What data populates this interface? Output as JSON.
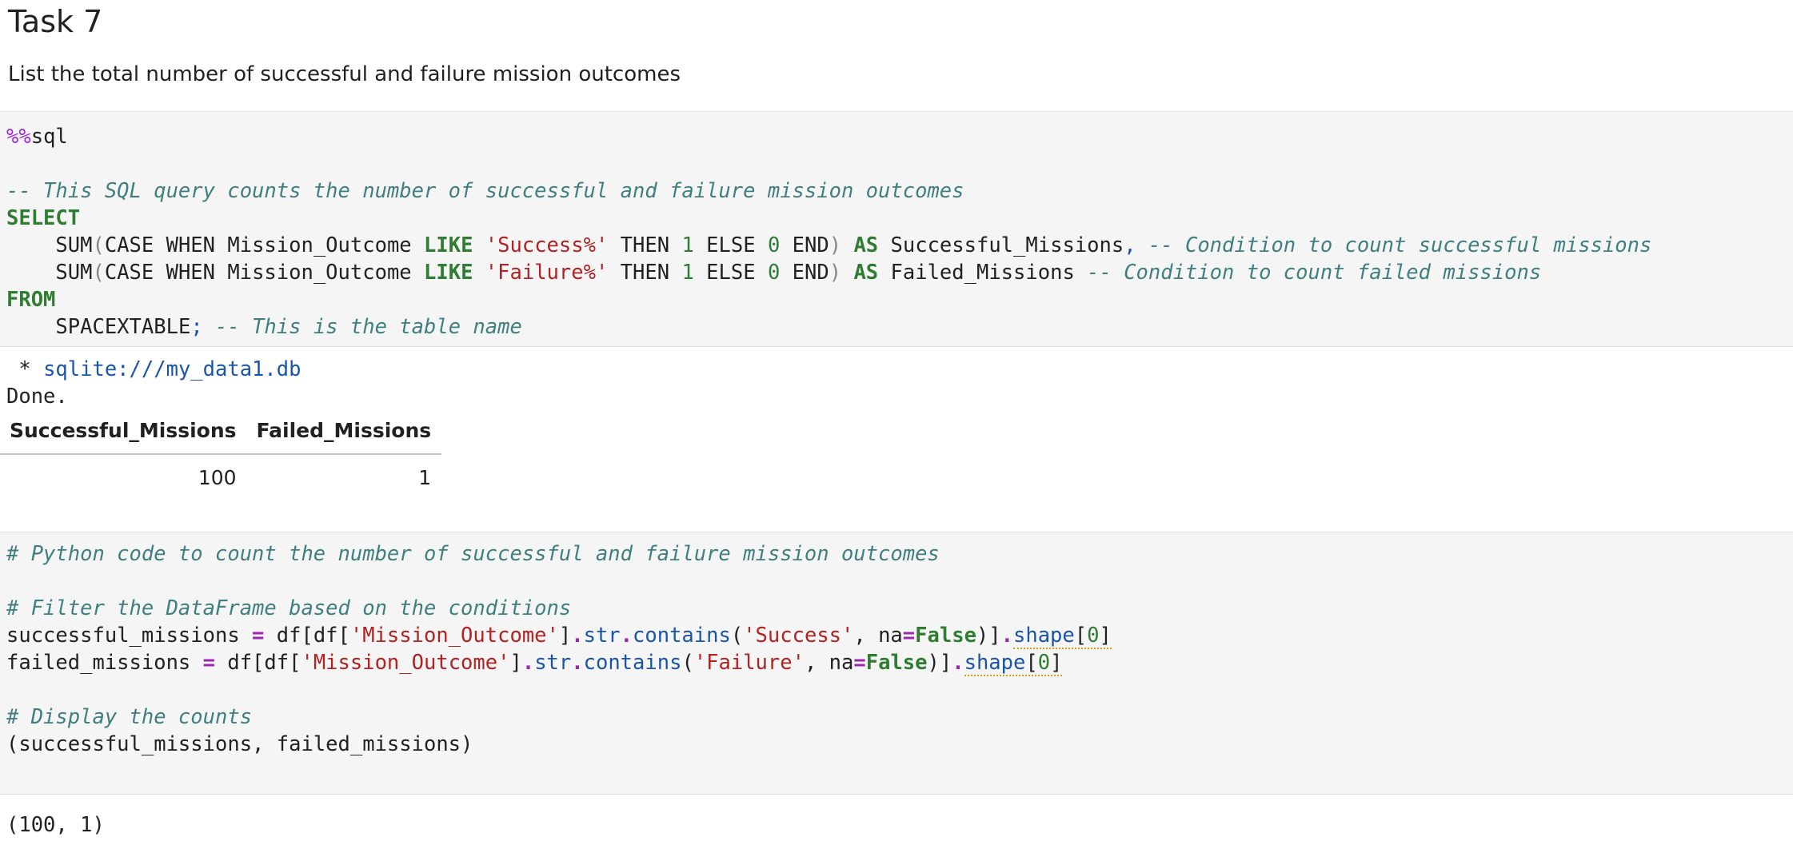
{
  "markdown": {
    "heading": "Task 7",
    "description": "List the total number of successful and failure mission outcomes"
  },
  "sql_cell": {
    "magic_prefix": "%%",
    "magic_name": "sql",
    "comment_line": "-- This SQL query counts the number of successful and failure mission outcomes",
    "kw_select": "SELECT",
    "kw_from": "FROM",
    "line1": {
      "sum": "SUM",
      "case_when": "CASE WHEN Mission_Outcome ",
      "like": "LIKE",
      "pattern": "'Success%'",
      "then": " THEN ",
      "one": "1",
      "else": " ELSE ",
      "zero": "0",
      "end": " END",
      "as": "AS",
      "alias": " Successful_Missions",
      "comma": ",",
      "comment": " -- Condition to count successful missions"
    },
    "line2": {
      "sum": "SUM",
      "case_when": "CASE WHEN Mission_Outcome ",
      "like": "LIKE",
      "pattern": "'Failure%'",
      "then": " THEN ",
      "one": "1",
      "else": " ELSE ",
      "zero": "0",
      "end": " END",
      "as": "AS",
      "alias": " Failed_Missions",
      "comment": " -- Condition to count failed missions"
    },
    "table_name": "SPACEXTABLE",
    "semicolon": ";",
    "table_comment": " -- This is the table name"
  },
  "sql_output": {
    "bullet": " * ",
    "connection": "sqlite:///my_data1.db",
    "status": "Done.",
    "columns": [
      "Successful_Missions",
      "Failed_Missions"
    ],
    "rows": [
      [
        "100",
        "1"
      ]
    ]
  },
  "python_cell": {
    "comment1": "# Python code to count the number of successful and failure mission outcomes",
    "comment2": "# Filter the DataFrame based on the conditions",
    "comment3": "# Display the counts",
    "line1": {
      "var": "successful_missions ",
      "eq": "=",
      "df_open": " df[df[",
      "col": "'Mission_Outcome'",
      "close_bracket": "]",
      "dot1": ".",
      "str": "str",
      "dot2": ".",
      "contains": "contains",
      "open_paren": "(",
      "arg": "'Success'",
      "sep": ", na",
      "eq2": "=",
      "false": "False",
      "tail": ")]",
      "dot3": ".",
      "shape": "shape",
      "idx_open": "[",
      "idx": "0",
      "idx_close": "]"
    },
    "line2": {
      "var": "failed_missions ",
      "eq": "=",
      "df_open": " df[df[",
      "col": "'Mission_Outcome'",
      "close_bracket": "]",
      "dot1": ".",
      "str": "str",
      "dot2": ".",
      "contains": "contains",
      "open_paren": "(",
      "arg": "'Failure'",
      "sep": ", na",
      "eq2": "=",
      "false": "False",
      "tail": ")]",
      "dot3": ".",
      "shape": "shape",
      "idx_open": "[",
      "idx": "0",
      "idx_close": "]"
    },
    "last_line": "(successful_missions, failed_missions)"
  },
  "python_output": {
    "result": "(100, 1)"
  },
  "colors": {
    "keyword": "#2e7d32",
    "string": "#b22222",
    "comment": "#3f7f7f",
    "operator": "#9c27b0",
    "link": "#1a56a8",
    "cell_background": "#f5f5f5"
  }
}
